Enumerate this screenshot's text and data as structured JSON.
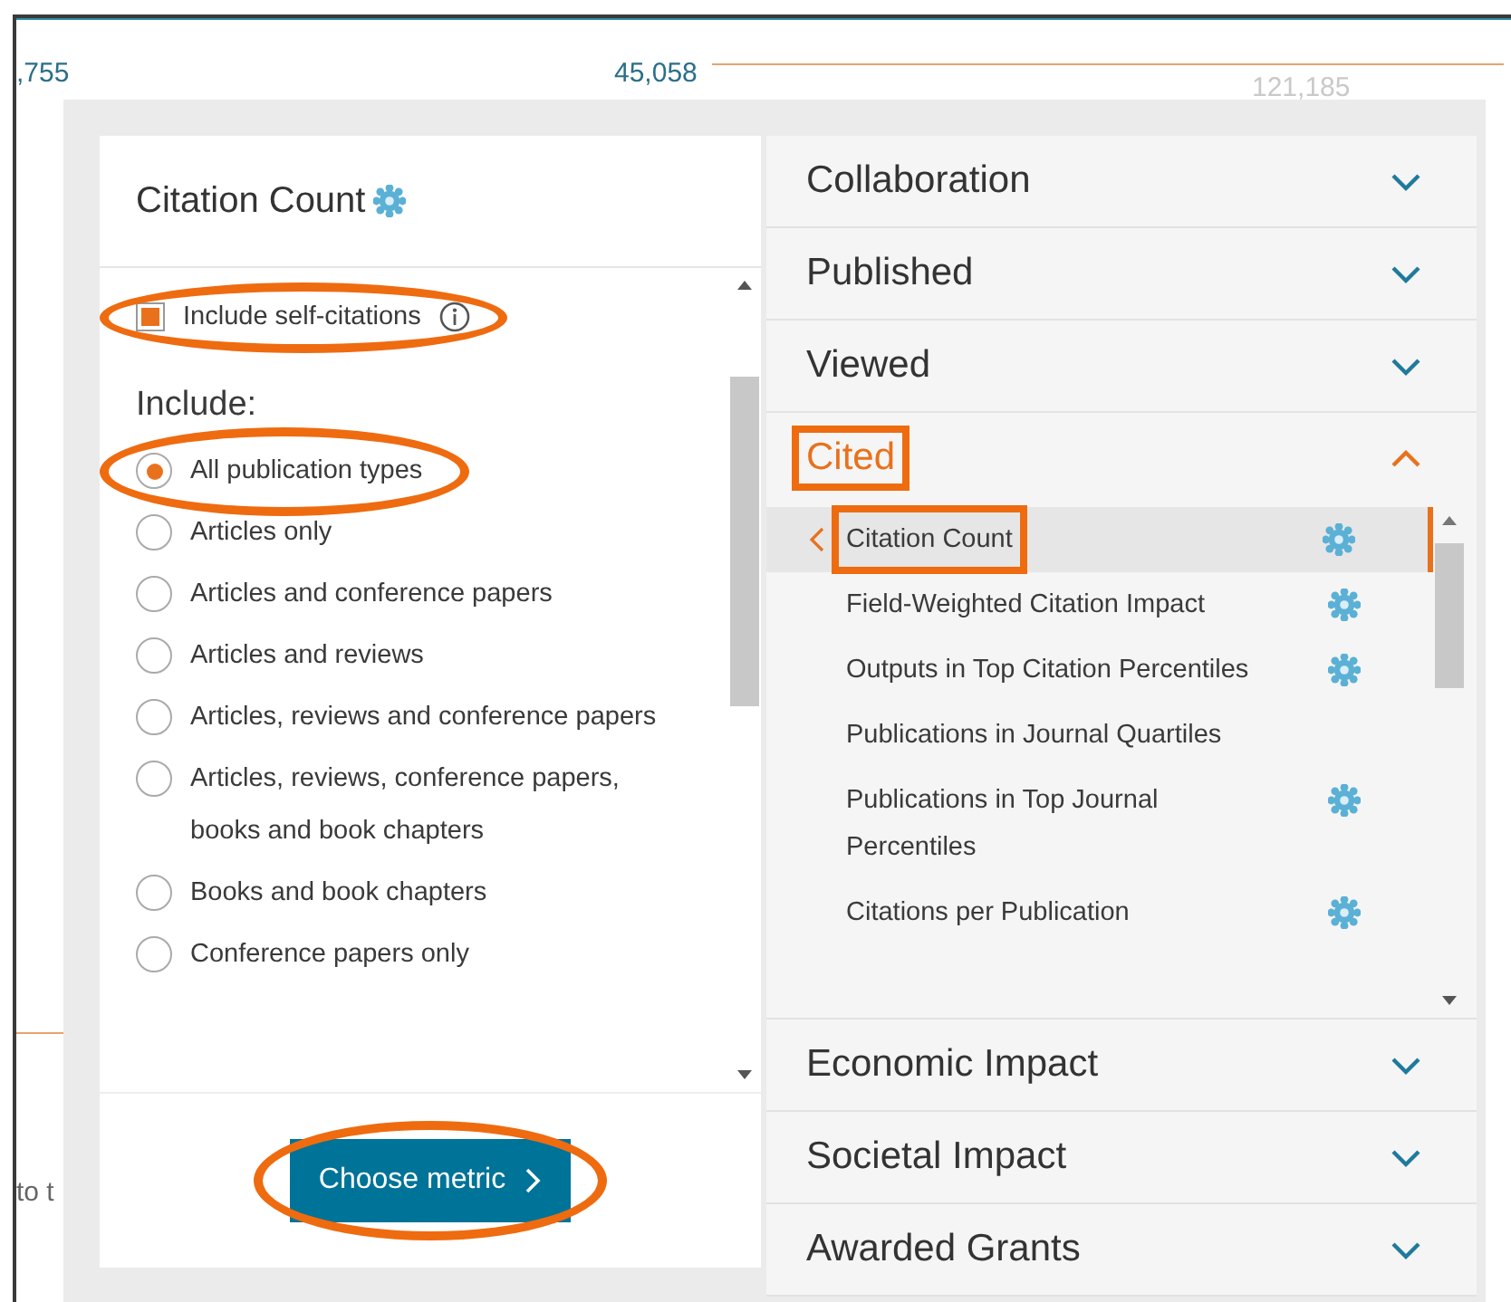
{
  "background": {
    "values": [
      ",755",
      "45,058",
      "121,185"
    ],
    "note": "to t"
  },
  "metric_panel": {
    "title": "Citation Count",
    "premium": true,
    "self_citations": {
      "label": "Include self-citations",
      "checked": true,
      "highlighted": true
    },
    "include_label": "Include:",
    "options": [
      {
        "label": "All publication types",
        "selected": true,
        "highlighted": true
      },
      {
        "label": "Articles only",
        "selected": false
      },
      {
        "label": "Articles and conference papers",
        "selected": false
      },
      {
        "label": "Articles and reviews",
        "selected": false
      },
      {
        "label": "Articles, reviews and conference papers",
        "selected": false
      },
      {
        "label": "Articles, reviews, conference papers, books and book chapters",
        "selected": false
      },
      {
        "label": "Books and book chapters",
        "selected": false
      },
      {
        "label": "Conference papers only",
        "selected": false
      }
    ],
    "button": {
      "label": "Choose metric",
      "highlighted": true
    }
  },
  "categories": [
    {
      "label": "Collaboration",
      "expanded": false
    },
    {
      "label": "Published",
      "expanded": false
    },
    {
      "label": "Viewed",
      "expanded": false
    },
    {
      "label": "Cited",
      "expanded": true,
      "highlighted": true,
      "items": [
        {
          "label": "Citation Count",
          "premium": true,
          "selected": true,
          "highlighted": true
        },
        {
          "label": "Field-Weighted Citation Impact",
          "premium": true,
          "selected": false
        },
        {
          "label": "Outputs in Top Citation Percentiles",
          "premium": true,
          "selected": false
        },
        {
          "label": "Publications in Journal Quartiles",
          "premium": false,
          "selected": false
        },
        {
          "label": "Publications in Top Journal Percentiles",
          "premium": true,
          "selected": false
        },
        {
          "label": "Citations per Publication",
          "premium": true,
          "selected": false
        }
      ]
    },
    {
      "label": "Economic Impact",
      "expanded": false
    },
    {
      "label": "Societal Impact",
      "expanded": false
    },
    {
      "label": "Awarded Grants",
      "expanded": false
    }
  ]
}
